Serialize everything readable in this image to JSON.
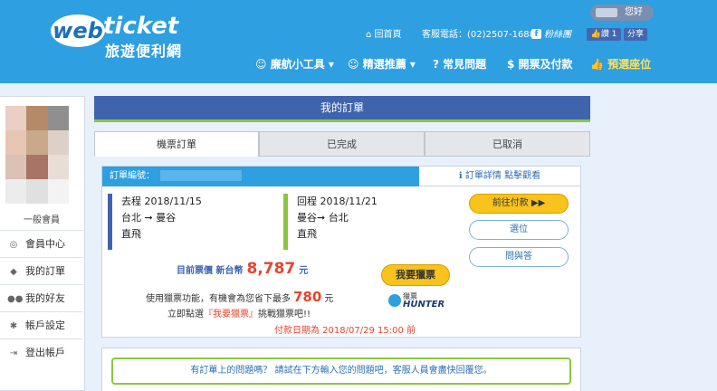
{
  "brand": {
    "logo_web": "web",
    "logo_ticket": "ticket",
    "logo_sub": "旅遊便利網"
  },
  "header": {
    "greeting": "您好",
    "home": "回首頁",
    "phone": "客服電話：(02)2507-1688",
    "fb_text": "粉絲團",
    "like": "讚 1",
    "share": "分享"
  },
  "nav": {
    "tools": "廉航小工具",
    "picks": "精選推薦",
    "faq": "常見問題",
    "pay": "開票及付款",
    "pre": "預選座位"
  },
  "sidebar": {
    "member_type": "一般會員",
    "items": [
      {
        "label": "會員中心",
        "icon": "user-icon"
      },
      {
        "label": "我的訂單",
        "icon": "tag-icon"
      },
      {
        "label": "我的好友",
        "icon": "friends-icon"
      },
      {
        "label": "帳戶設定",
        "icon": "gear-icon"
      },
      {
        "label": "登出帳戶",
        "icon": "logout-icon"
      }
    ]
  },
  "main": {
    "title": "我的訂單",
    "tabs": [
      "機票訂單",
      "已完成",
      "已取消"
    ],
    "order": {
      "no_label": "訂單編號：",
      "detail_link": "訂單詳情 點擊觀看",
      "outbound": {
        "label": "去程",
        "date": "2018/11/15",
        "route_from": "台北",
        "route_to": "曼谷",
        "type": "直飛"
      },
      "return": {
        "label": "回程",
        "date": "2018/11/21",
        "route_from": "曼谷",
        "route_to": "台北",
        "type": "直飛"
      },
      "buttons": {
        "pay": "前往付款",
        "seat": "選位",
        "qa": "問與答"
      },
      "price_label": "目前票價 新台幣",
      "price": "8,787",
      "price_unit": "元",
      "hunt_button": "我要獵票",
      "save_pre": "使用獵票功能，有機會為您省下最多",
      "save_amount": "780",
      "save_unit": "元",
      "try_pre": "立即點選",
      "try_link": "『我要獵票』",
      "try_post": "挑戰獵票吧!!",
      "hunter_mini": "獵票",
      "hunter_big": "HUNTER",
      "deadline": "付款日期為 2018/07/29 15:00 前"
    },
    "question": "有訂單上的問題嗎？ 請試在下方輸入您的問題吧，客服人員會盡快回覆您。"
  },
  "colors": {
    "header_bg": "#2e9fe0",
    "title_bg": "#3f64ad",
    "accent_green": "#8cc63f",
    "pay_yellow": "#f7c31c",
    "price_red": "#e8442e"
  }
}
